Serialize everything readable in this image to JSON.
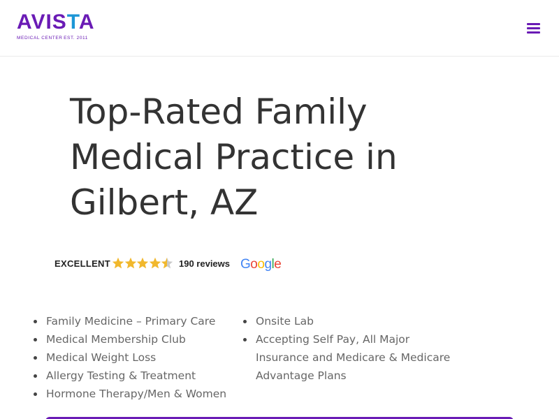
{
  "brand": {
    "name_part1": "AVIS",
    "name_part2": "T",
    "name_part3": "A",
    "subtitle": "MEDICAL CENTER",
    "est": "EST. 2011",
    "colors": {
      "primary": "#6a1bb5",
      "secondary": "#1c96d6"
    }
  },
  "header": {
    "menu_icon": "hamburger-menu-icon"
  },
  "hero": {
    "title_line1": "Top-Rated Family",
    "title_line2": "Medical Practice in",
    "title_line3": "Gilbert, AZ"
  },
  "rating": {
    "label": "EXCELLENT",
    "stars": 4.5,
    "count_text": "190 reviews",
    "provider": {
      "G": "G",
      "o1": "o",
      "o2": "o",
      "g": "g",
      "l": "l",
      "e": "e"
    }
  },
  "features": {
    "left": [
      "Family Medicine – Primary Care",
      "Medical Membership Club",
      "Medical Weight Loss",
      "Allergy Testing & Treatment",
      "Hormone Therapy/Men & Women"
    ],
    "right": [
      "Onsite Lab",
      "Accepting Self Pay, All Major Insurance and Medicare & Medicare Advantage Plans"
    ]
  }
}
